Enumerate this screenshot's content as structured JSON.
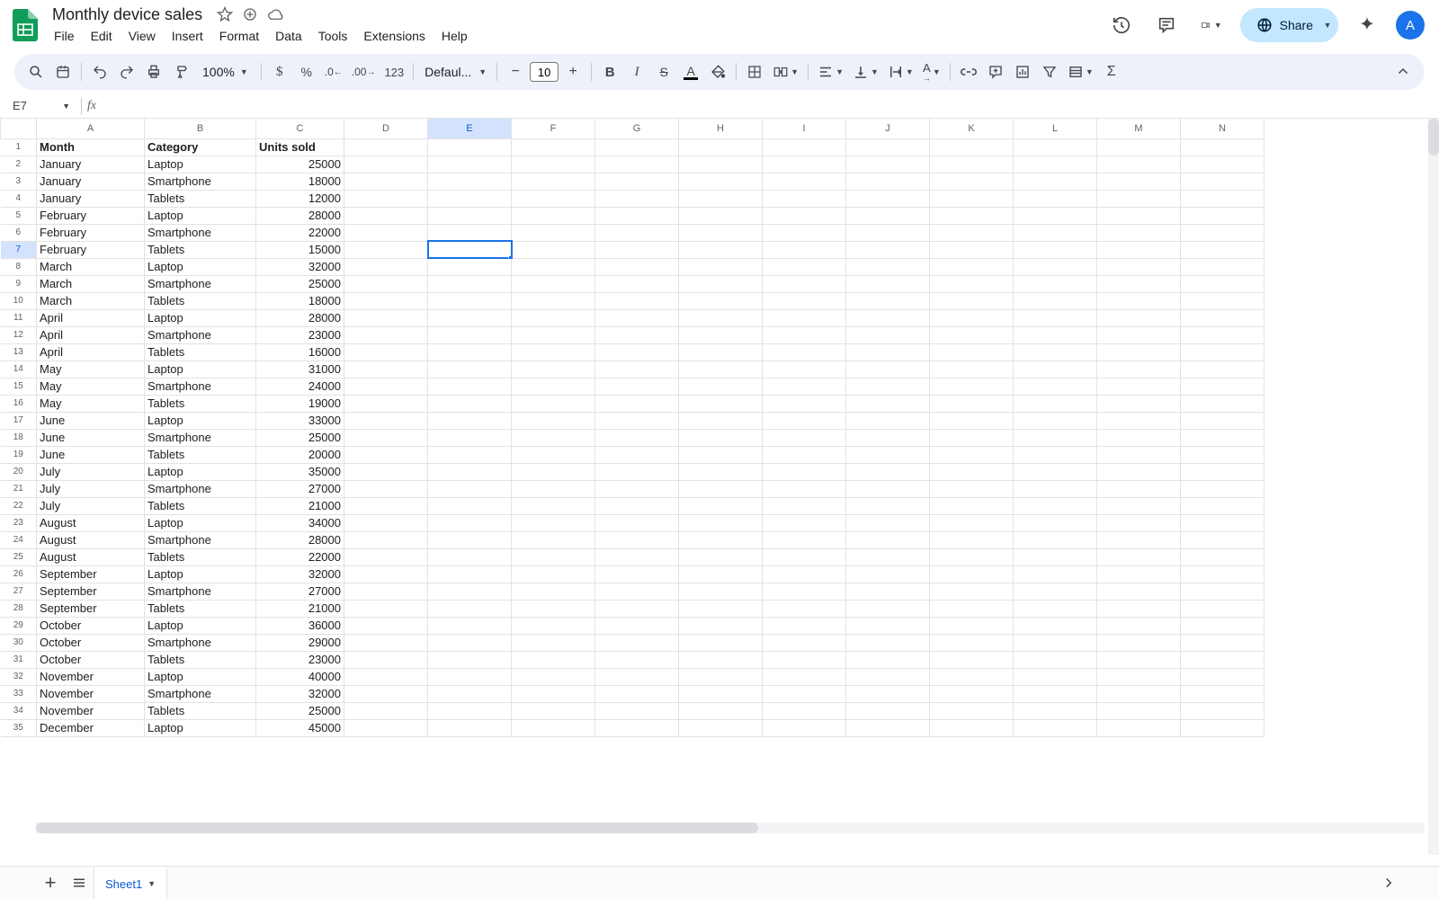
{
  "doc": {
    "title": "Monthly device sales"
  },
  "menus": [
    "File",
    "Edit",
    "View",
    "Insert",
    "Format",
    "Data",
    "Tools",
    "Extensions",
    "Help"
  ],
  "header": {
    "share": "Share",
    "avatar": "A"
  },
  "toolbar": {
    "zoom": "100%",
    "font": "Defaul...",
    "fontSize": "10",
    "fmt123": "123"
  },
  "nameBox": "E7",
  "fxValue": "",
  "columns": [
    "A",
    "B",
    "C",
    "D",
    "E",
    "F",
    "G",
    "H",
    "I",
    "J",
    "K",
    "L",
    "M",
    "N"
  ],
  "selectedCol": "E",
  "selectedRow": 7,
  "selectedCell": "E7",
  "headerRow": [
    "Month",
    "Category",
    "Units sold"
  ],
  "rows": [
    [
      "January",
      "Laptop",
      "25000"
    ],
    [
      "January",
      "Smartphone",
      "18000"
    ],
    [
      "January",
      "Tablets",
      "12000"
    ],
    [
      "February",
      "Laptop",
      "28000"
    ],
    [
      "February",
      "Smartphone",
      "22000"
    ],
    [
      "February",
      "Tablets",
      "15000"
    ],
    [
      "March",
      "Laptop",
      "32000"
    ],
    [
      "March",
      "Smartphone",
      "25000"
    ],
    [
      "March",
      "Tablets",
      "18000"
    ],
    [
      "April",
      "Laptop",
      "28000"
    ],
    [
      "April",
      "Smartphone",
      "23000"
    ],
    [
      "April",
      "Tablets",
      "16000"
    ],
    [
      "May",
      "Laptop",
      "31000"
    ],
    [
      "May",
      "Smartphone",
      "24000"
    ],
    [
      "May",
      "Tablets",
      "19000"
    ],
    [
      "June",
      "Laptop",
      "33000"
    ],
    [
      "June",
      "Smartphone",
      "25000"
    ],
    [
      "June",
      "Tablets",
      "20000"
    ],
    [
      "July",
      "Laptop",
      "35000"
    ],
    [
      "July",
      "Smartphone",
      "27000"
    ],
    [
      "July",
      "Tablets",
      "21000"
    ],
    [
      "August",
      "Laptop",
      "34000"
    ],
    [
      "August",
      "Smartphone",
      "28000"
    ],
    [
      "August",
      "Tablets",
      "22000"
    ],
    [
      "September",
      "Laptop",
      "32000"
    ],
    [
      "September",
      "Smartphone",
      "27000"
    ],
    [
      "September",
      "Tablets",
      "21000"
    ],
    [
      "October",
      "Laptop",
      "36000"
    ],
    [
      "October",
      "Smartphone",
      "29000"
    ],
    [
      "October",
      "Tablets",
      "23000"
    ],
    [
      "November",
      "Laptop",
      "40000"
    ],
    [
      "November",
      "Smartphone",
      "32000"
    ],
    [
      "November",
      "Tablets",
      "25000"
    ],
    [
      "December",
      "Laptop",
      "45000"
    ]
  ],
  "sheets": {
    "active": "Sheet1"
  }
}
